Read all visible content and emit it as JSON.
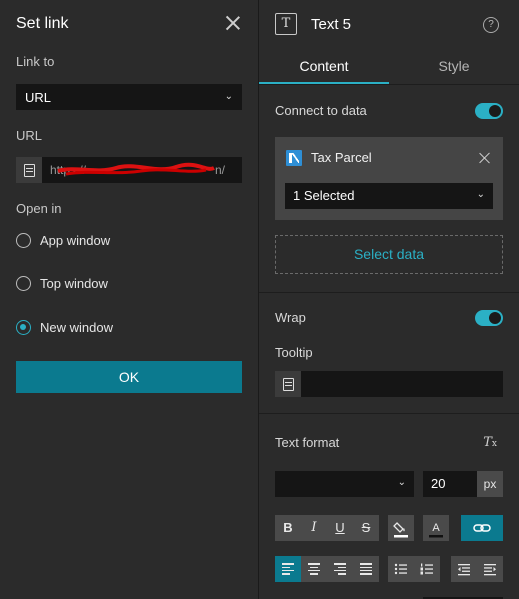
{
  "left": {
    "title": "Set link",
    "link_to_label": "Link to",
    "link_to_value": "URL",
    "url_label": "URL",
    "url_value": "https://",
    "url_tail": "n/",
    "open_in_label": "Open in",
    "radios": [
      {
        "label": "App window",
        "selected": false
      },
      {
        "label": "Top window",
        "selected": false
      },
      {
        "label": "New window",
        "selected": true
      }
    ],
    "ok_label": "OK"
  },
  "right": {
    "title": "Text 5",
    "tab_content": "Content",
    "tab_style": "Style",
    "connect_label": "Connect to data",
    "datasource_name": "Tax Parcel",
    "datasource_selected": "1 Selected",
    "select_data_label": "Select data",
    "wrap_label": "Wrap",
    "tooltip_label": "Tooltip",
    "text_format_label": "Text format",
    "font_size": "20",
    "font_unit": "px",
    "help_glyph": "?"
  },
  "colors": {
    "accent": "#2bb0c5",
    "ok_button": "#0b7a8f",
    "datasource_icon": "#2e8fd6"
  }
}
